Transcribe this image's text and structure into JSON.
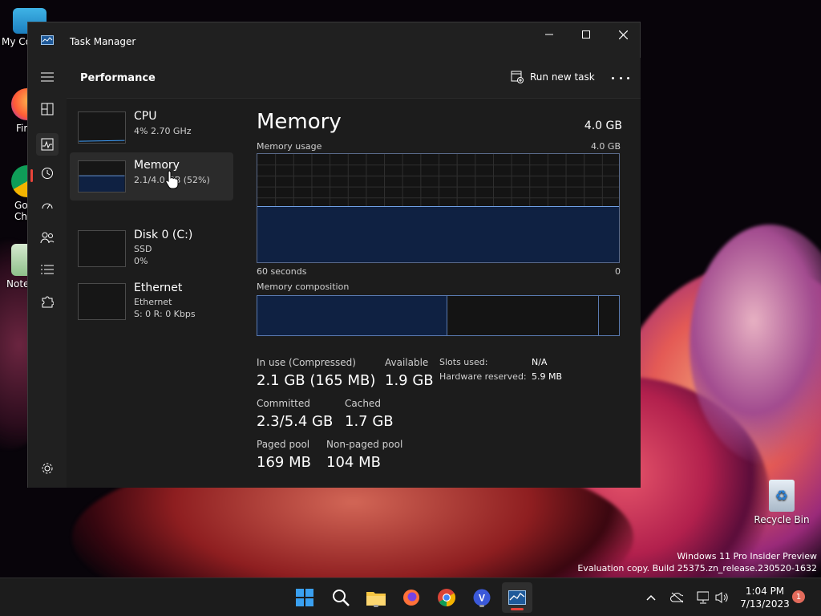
{
  "desktop": {
    "icons": [
      {
        "label": "My Co"
      },
      {
        "label": "Fir"
      },
      {
        "label": "Go Chi"
      },
      {
        "label": "Note"
      },
      {
        "label": "Recycle Bin"
      }
    ],
    "watermark": {
      "line1": "Windows 11 Pro Insider Preview",
      "line2": "Evaluation copy. Build 25375.zn_release.230520-1632"
    }
  },
  "window": {
    "title": "Task Manager",
    "page_title": "Performance",
    "run_new_task_label": "Run new task"
  },
  "resources": [
    {
      "name": "CPU",
      "sub1": "4% 2.70 GHz",
      "sub2": "",
      "sub3": ""
    },
    {
      "name": "Memory",
      "sub1": "2.1/4.0 GB (52%)",
      "sub2": "",
      "sub3": ""
    },
    {
      "name": "Disk 0 (C:)",
      "sub1": "SSD",
      "sub2": "0%",
      "sub3": ""
    },
    {
      "name": "Ethernet",
      "sub1": "Ethernet",
      "sub2": "S: 0 R: 0 Kbps",
      "sub3": ""
    }
  ],
  "detail": {
    "title": "Memory",
    "total": "4.0 GB",
    "usage_label": "Memory usage",
    "usage_max": "4.0 GB",
    "usage_fraction": 0.52,
    "axis_left": "60 seconds",
    "axis_right": "0",
    "composition_label": "Memory composition",
    "composition_fractions": [
      0.525,
      0.42,
      0.055
    ],
    "stats": {
      "in_use_label": "In use (Compressed)",
      "in_use_value": "2.1 GB (165 MB)",
      "available_label": "Available",
      "available_value": "1.9 GB",
      "committed_label": "Committed",
      "committed_value": "2.3/5.4 GB",
      "cached_label": "Cached",
      "cached_value": "1.7 GB",
      "paged_label": "Paged pool",
      "paged_value": "169 MB",
      "nonpaged_label": "Non-paged pool",
      "nonpaged_value": "104 MB",
      "slots_label": "Slots used:",
      "slots_value": "N/A",
      "hw_reserved_label": "Hardware reserved:",
      "hw_reserved_value": "5.9 MB"
    }
  },
  "taskbar": {
    "time": "1:04 PM",
    "date": "7/13/2023",
    "notification_count": "1"
  },
  "colors": {
    "accent": "#e8443a",
    "memory_fill": "#0f2142",
    "memory_line": "#6fa0e6"
  }
}
